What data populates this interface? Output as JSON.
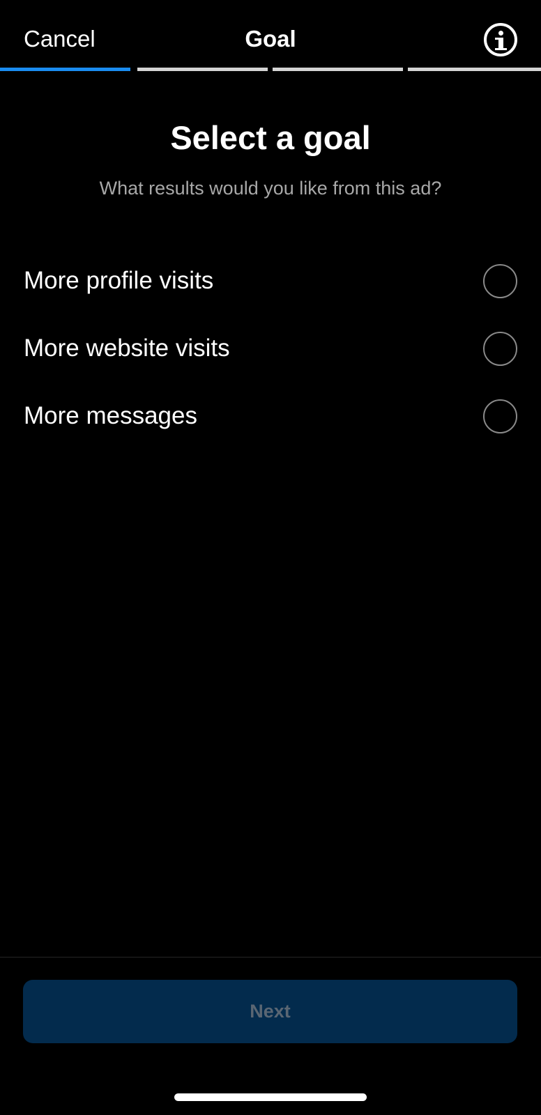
{
  "header": {
    "cancel_label": "Cancel",
    "title": "Goal",
    "info_icon": "info-circle-icon"
  },
  "progress": {
    "total_steps": 4,
    "current_step": 1,
    "active_color": "#1a8cf0",
    "inactive_color": "#d4d4d4"
  },
  "content": {
    "heading": "Select a goal",
    "subheading": "What results would you like from this ad?"
  },
  "options": [
    {
      "label": "More profile visits",
      "selected": false
    },
    {
      "label": "More website visits",
      "selected": false
    },
    {
      "label": "More messages",
      "selected": false
    }
  ],
  "footer": {
    "next_label": "Next",
    "next_enabled": false,
    "button_color": "#032b4d"
  }
}
